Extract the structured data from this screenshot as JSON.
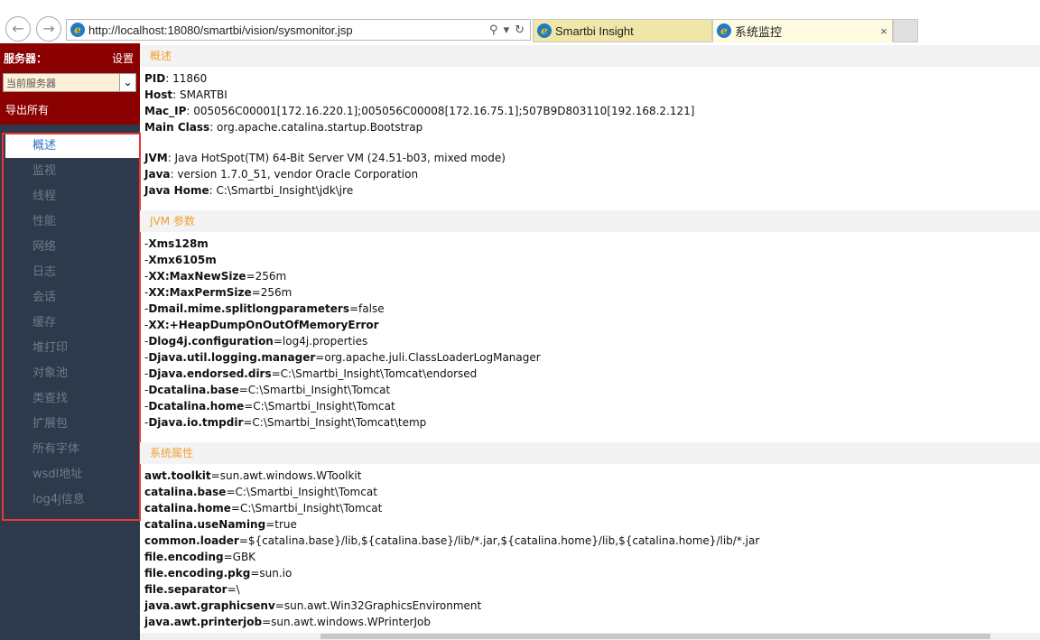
{
  "browser": {
    "url": "http://localhost:18080/smartbi/vision/sysmonitor.jsp",
    "tabs": [
      {
        "label": "Smartbi Insight"
      },
      {
        "label": "系统监控"
      }
    ],
    "close_glyph": "×"
  },
  "sidebar": {
    "server_title": "服务器：",
    "settings_label": "设置",
    "server_select_value": "当前服务器",
    "export_label": "导出所有",
    "menu": [
      "概述",
      "监视",
      "线程",
      "性能",
      "网络",
      "日志",
      "会话",
      "缓存",
      "堆打印",
      "对象池",
      "类查找",
      "扩展包",
      "所有字体",
      "wsdl地址",
      "log4j信息"
    ],
    "active_index": 0
  },
  "sections": {
    "overview": {
      "title": "概述",
      "rows": [
        {
          "key": "PID",
          "val": ": 11860"
        },
        {
          "key": "Host",
          "val": ": SMARTBI"
        },
        {
          "key": "Mac_IP",
          "val": ": 005056C00001[172.16.220.1];005056C00008[172.16.75.1];507B9D803110[192.168.2.121]"
        },
        {
          "key": "Main Class",
          "val": ": org.apache.catalina.startup.Bootstrap"
        },
        {
          "key": "JVM",
          "val": ": Java HotSpot(TM) 64-Bit Server VM (24.51-b03, mixed mode)"
        },
        {
          "key": "Java",
          "val": ": version 1.7.0_51, vendor Oracle Corporation"
        },
        {
          "key": "Java Home",
          "val": ": C:\\Smartbi_Insight\\jdk\\jre"
        }
      ]
    },
    "jvm": {
      "title": "JVM 参数",
      "rows": [
        {
          "pre": "-",
          "key": "Xms128m",
          "val": ""
        },
        {
          "pre": "-",
          "key": "Xmx6105m",
          "val": ""
        },
        {
          "pre": "-",
          "key": "XX:MaxNewSize",
          "val": "=256m"
        },
        {
          "pre": "-",
          "key": "XX:MaxPermSize",
          "val": "=256m"
        },
        {
          "pre": "-",
          "key": "Dmail.mime.splitlongparameters",
          "val": "=false"
        },
        {
          "pre": "-",
          "key": "XX:+HeapDumpOnOutOfMemoryError",
          "val": ""
        },
        {
          "pre": "-",
          "key": "Dlog4j.configuration",
          "val": "=log4j.properties"
        },
        {
          "pre": "-",
          "key": "Djava.util.logging.manager",
          "val": "=org.apache.juli.ClassLoaderLogManager"
        },
        {
          "pre": "-",
          "key": "Djava.endorsed.dirs",
          "val": "=C:\\Smartbi_Insight\\Tomcat\\endorsed"
        },
        {
          "pre": "-",
          "key": "Dcatalina.base",
          "val": "=C:\\Smartbi_Insight\\Tomcat"
        },
        {
          "pre": "-",
          "key": "Dcatalina.home",
          "val": "=C:\\Smartbi_Insight\\Tomcat"
        },
        {
          "pre": "-",
          "key": "Djava.io.tmpdir",
          "val": "=C:\\Smartbi_Insight\\Tomcat\\temp"
        }
      ]
    },
    "sysprops": {
      "title": "系统属性",
      "rows": [
        {
          "key": "awt.toolkit",
          "val": "=sun.awt.windows.WToolkit"
        },
        {
          "key": "catalina.base",
          "val": "=C:\\Smartbi_Insight\\Tomcat"
        },
        {
          "key": "catalina.home",
          "val": "=C:\\Smartbi_Insight\\Tomcat"
        },
        {
          "key": "catalina.useNaming",
          "val": "=true"
        },
        {
          "key": "common.loader",
          "val": "=${catalina.base}/lib,${catalina.base}/lib/*.jar,${catalina.home}/lib,${catalina.home}/lib/*.jar"
        },
        {
          "key": "file.encoding",
          "val": "=GBK"
        },
        {
          "key": "file.encoding.pkg",
          "val": "=sun.io"
        },
        {
          "key": "file.separator",
          "val": "=\\"
        },
        {
          "key": "java.awt.graphicsenv",
          "val": "=sun.awt.Win32GraphicsEnvironment"
        },
        {
          "key": "java.awt.printerjob",
          "val": "=sun.awt.windows.WPrinterJob"
        }
      ]
    }
  }
}
